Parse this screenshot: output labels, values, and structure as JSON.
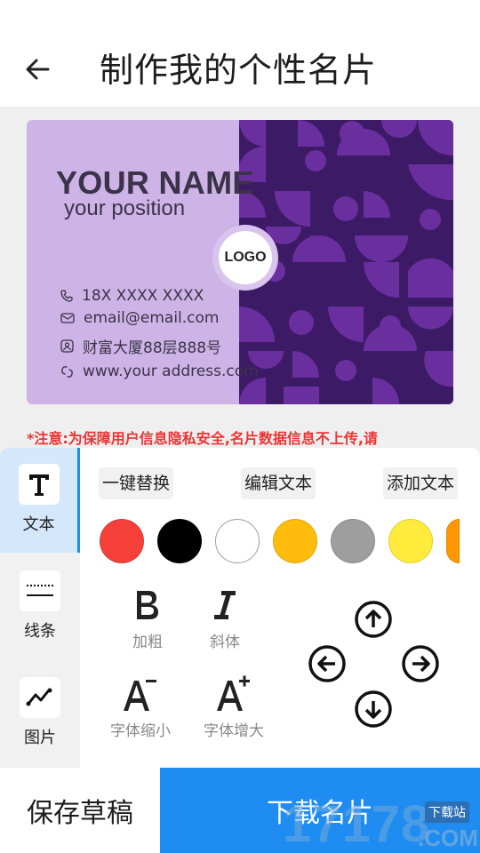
{
  "header": {
    "title": "制作我的个性名片"
  },
  "card": {
    "name": "YOUR NAME",
    "position": "your position",
    "logo": "LOGO",
    "phone": "18X XXXX XXXX",
    "email": "email@email.com",
    "address": "财富大厦88层888号",
    "website": "www.your address.com"
  },
  "notice": "*注意:为保障用户信息隐私安全,名片数据信息不上传,请",
  "sidebar": {
    "items": [
      {
        "label": "文本",
        "icon": "text-icon"
      },
      {
        "label": "线条",
        "icon": "line-icon"
      },
      {
        "label": "图片",
        "icon": "image-icon"
      }
    ]
  },
  "actions": {
    "replace": "一键替换",
    "edit_text": "编辑文本",
    "add_text": "添加文本"
  },
  "colors": [
    "#f5403a",
    "#000000",
    "#ffffff",
    "#ffbc0d",
    "#9e9e9e",
    "#ffeb3b",
    "#ff9800"
  ],
  "tools": {
    "bold": "加粗",
    "italic": "斜体",
    "shrink": "字体缩小",
    "enlarge": "字体增大"
  },
  "footer": {
    "save_draft": "保存草稿",
    "download": "下载名片"
  },
  "watermark": {
    "main": "17178",
    "suffix": ".COM",
    "tag": "下载站"
  }
}
